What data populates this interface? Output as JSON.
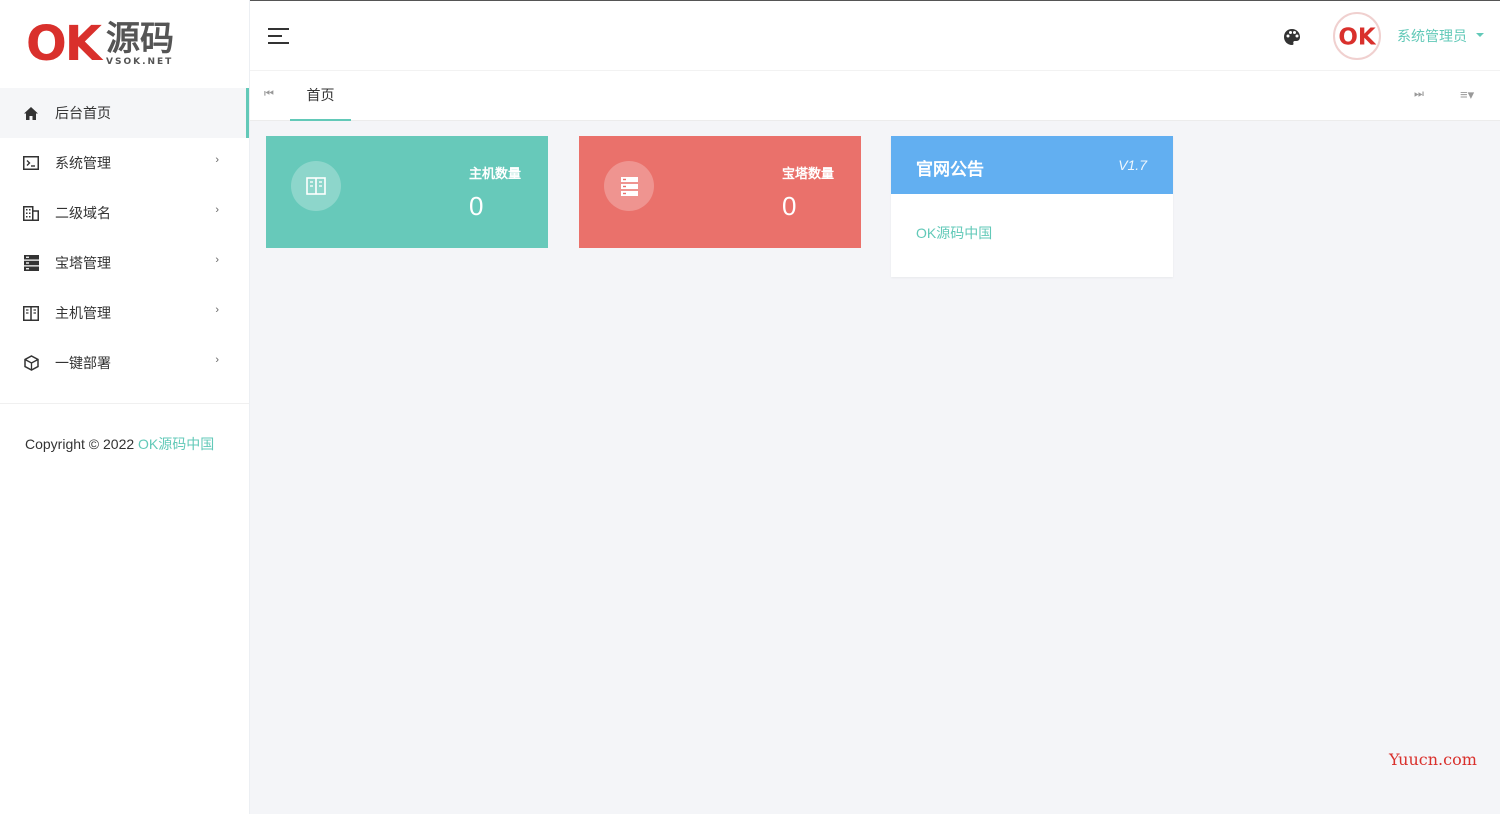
{
  "logo": {
    "main": "OK",
    "cn": "源码",
    "sub": "VSOK.NET"
  },
  "sidebar": {
    "items": [
      {
        "label": "后台首页",
        "icon": "home-icon",
        "active": true
      },
      {
        "label": "系统管理",
        "icon": "terminal-icon",
        "arrow": "›"
      },
      {
        "label": "二级域名",
        "icon": "building-icon",
        "arrow": "›"
      },
      {
        "label": "宝塔管理",
        "icon": "server-icon",
        "arrow": "›"
      },
      {
        "label": "主机管理",
        "icon": "book-icon",
        "arrow": "›"
      },
      {
        "label": "一键部署",
        "icon": "cube-icon",
        "arrow": "›"
      }
    ],
    "copyright_prefix": "Copyright © 2022 ",
    "copyright_brand": "OK源码中国"
  },
  "header": {
    "avatar_text": "OK",
    "user_name": "系统管理员"
  },
  "tabs": {
    "home_label": "首页",
    "prev_symbol": "⏮",
    "next_symbol": "⏭",
    "menu_symbol": "≡▾"
  },
  "cards": {
    "hosts": {
      "title": "主机数量",
      "value": "0",
      "color": "#67c9ba"
    },
    "baota": {
      "title": "宝塔数量",
      "value": "0",
      "color": "#ea716b"
    }
  },
  "notice": {
    "title": "官网公告",
    "version": "V1.7",
    "link_text": "OK源码中国",
    "color": "#62aff1"
  },
  "watermark": "Yuucn.com",
  "colors": {
    "accent": "#62c9b8",
    "brand_red": "#d9302c"
  }
}
